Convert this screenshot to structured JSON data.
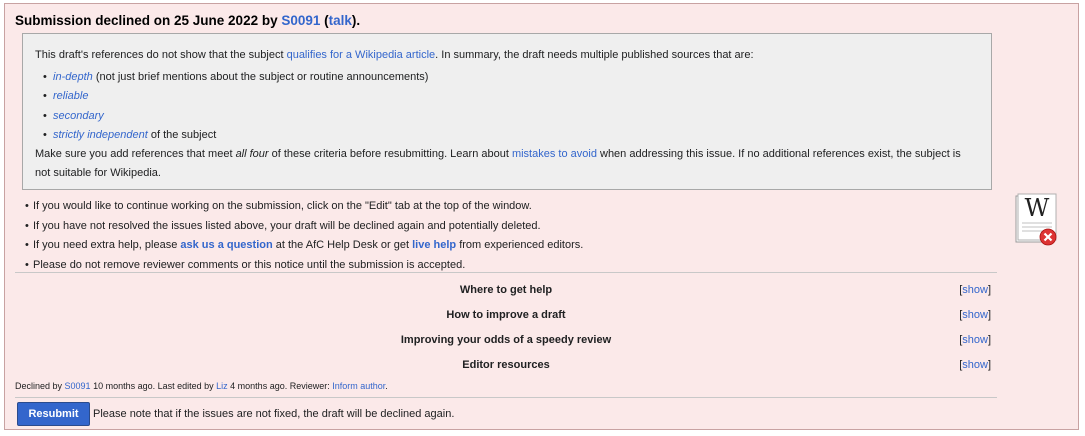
{
  "heading": {
    "prefix": "Submission declined on 25 June 2022 by ",
    "reviewer": "S0091",
    "open_paren": " (",
    "talk": "talk",
    "close_paren": ")."
  },
  "refbox": {
    "intro_before": "This draft's references do not show that the subject ",
    "intro_link": "qualifies for a Wikipedia article",
    "intro_after": ". In summary, the draft needs multiple published sources that are:",
    "criteria": [
      {
        "link": "in-depth",
        "text": " (not just brief mentions about the subject or routine announcements)"
      },
      {
        "link": "reliable",
        "text": ""
      },
      {
        "link": "secondary",
        "text": ""
      },
      {
        "link": "strictly independent",
        "text": " of the subject"
      }
    ],
    "after_1": "Make sure you add references that meet ",
    "after_em": "all four",
    "after_2": " of these criteria before resubmitting. Learn about ",
    "after_link": "mistakes to avoid",
    "after_3": " when addressing this issue. If no additional references exist, the subject is not suitable for Wikipedia."
  },
  "bullets": {
    "b1": "If you would like to continue working on the submission, click on the \"Edit\" tab at the top of the window.",
    "b2": "If you have not resolved the issues listed above, your draft will be declined again and potentially deleted.",
    "b3_before": "If you need extra help, please ",
    "b3_link1": "ask us a question",
    "b3_mid": " at the AfC Help Desk or get ",
    "b3_link2": "live help",
    "b3_after": " from experienced editors.",
    "b4": "Please do not remove reviewer comments or this notice until the submission is accepted."
  },
  "sections": [
    {
      "title": "Where to get help",
      "toggle": "show"
    },
    {
      "title": "How to improve a draft",
      "toggle": "show"
    },
    {
      "title": "Improving your odds of a speedy review",
      "toggle": "show"
    },
    {
      "title": "Editor resources",
      "toggle": "show"
    }
  ],
  "toggle_brackets": {
    "open": "[",
    "close": "]"
  },
  "footer": {
    "declined_by": "Declined by ",
    "reviewer": "S0091",
    "mid": " 10 months ago. Last edited by ",
    "editor": "Liz",
    "end": " 4 months ago. Reviewer: ",
    "inform": "Inform author",
    "period": "."
  },
  "resubmit_label": "Resubmit",
  "note": "Please note that if the issues are not fixed, the draft will be declined again.",
  "logo": {
    "letter": "W",
    "icon": "declined-wikipedia-logo-icon"
  },
  "colors": {
    "notice_bg": "#fbe9e9",
    "link": "#3366cc",
    "button": "#3366cc",
    "decline_red": "#d33"
  }
}
